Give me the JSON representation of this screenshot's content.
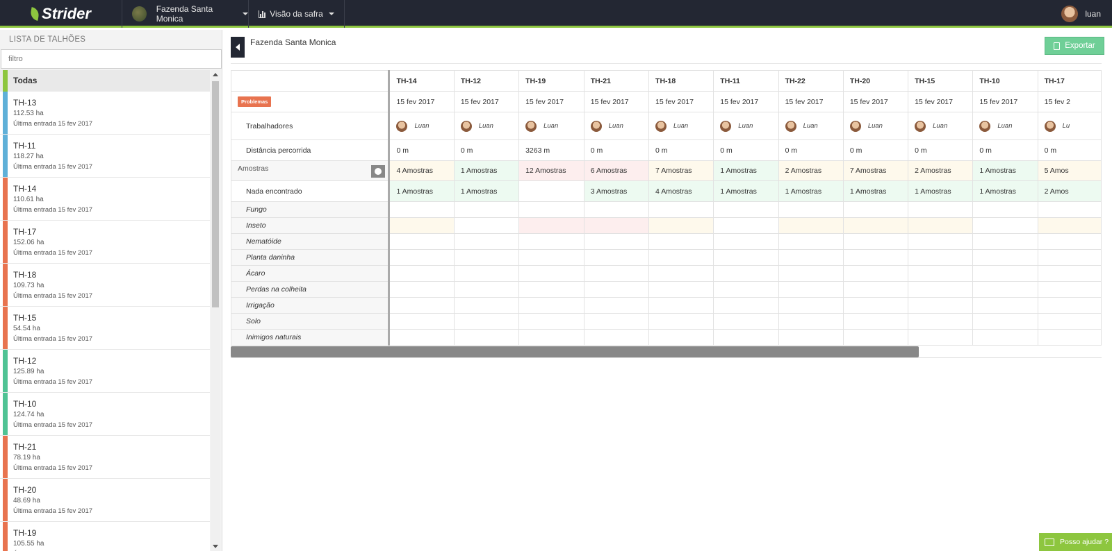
{
  "app": {
    "name": "Strider",
    "accent": "#8dc63f",
    "topbar_bg": "#232733"
  },
  "header": {
    "farm": "Fazenda Santa Monica",
    "view": "Visão da safra",
    "user": "luan"
  },
  "sidebar": {
    "title": "LISTA DE TALHÕES",
    "filter_placeholder": "filtro",
    "all_label": "Todas",
    "items": [
      {
        "name": "TH-13",
        "area": "112.53 ha",
        "last": "Última entrada 15 fev 2017",
        "color": "#5fb0d8"
      },
      {
        "name": "TH-11",
        "area": "118.27 ha",
        "last": "Última entrada 15 fev 2017",
        "color": "#5fb0d8"
      },
      {
        "name": "TH-14",
        "area": "110.61 ha",
        "last": "Última entrada 15 fev 2017",
        "color": "#e8734f"
      },
      {
        "name": "TH-17",
        "area": "152.06 ha",
        "last": "Última entrada 15 fev 2017",
        "color": "#e8734f"
      },
      {
        "name": "TH-18",
        "area": "109.73 ha",
        "last": "Última entrada 15 fev 2017",
        "color": "#e8734f"
      },
      {
        "name": "TH-15",
        "area": "54.54 ha",
        "last": "Última entrada 15 fev 2017",
        "color": "#e8734f"
      },
      {
        "name": "TH-12",
        "area": "125.89 ha",
        "last": "Última entrada 15 fev 2017",
        "color": "#4fc394"
      },
      {
        "name": "TH-10",
        "area": "124.74 ha",
        "last": "Última entrada 15 fev 2017",
        "color": "#4fc394"
      },
      {
        "name": "TH-21",
        "area": "78.19 ha",
        "last": "Última entrada 15 fev 2017",
        "color": "#e8734f"
      },
      {
        "name": "TH-20",
        "area": "48.69 ha",
        "last": "Última entrada 15 fev 2017",
        "color": "#e8734f"
      },
      {
        "name": "TH-19",
        "area": "105.55 ha",
        "last": "Última entrada 15 fev 2017",
        "color": "#e8734f"
      }
    ]
  },
  "main": {
    "title": "Fazenda Santa Monica",
    "export_label": "Exportar",
    "columns": [
      "TH-14",
      "TH-12",
      "TH-19",
      "TH-21",
      "TH-18",
      "TH-11",
      "TH-22",
      "TH-20",
      "TH-15",
      "TH-10",
      "TH-17"
    ],
    "problems_badge": "Problemas",
    "dates": [
      "15 fev 2017",
      "15 fev 2017",
      "15 fev 2017",
      "15 fev 2017",
      "15 fev 2017",
      "15 fev 2017",
      "15 fev 2017",
      "15 fev 2017",
      "15 fev 2017",
      "15 fev 2017",
      "15 fev 2"
    ],
    "workers_label": "Trabalhadores",
    "workers": [
      "Luan",
      "Luan",
      "Luan",
      "Luan",
      "Luan",
      "Luan",
      "Luan",
      "Luan",
      "Luan",
      "Luan",
      "Lu"
    ],
    "distance_label": "Distância percorrida",
    "distances": [
      "0 m",
      "0 m",
      "3263 m",
      "0 m",
      "0 m",
      "0 m",
      "0 m",
      "0 m",
      "0 m",
      "0 m",
      "0 m"
    ],
    "samples_label": "Amostras",
    "samples": [
      {
        "text": "4 Amostras",
        "status": "yellow"
      },
      {
        "text": "1 Amostras",
        "status": "green"
      },
      {
        "text": "12 Amostras",
        "status": "red"
      },
      {
        "text": "6 Amostras",
        "status": "red"
      },
      {
        "text": "7 Amostras",
        "status": "yellow"
      },
      {
        "text": "1 Amostras",
        "status": "green"
      },
      {
        "text": "2 Amostras",
        "status": "yellow"
      },
      {
        "text": "7 Amostras",
        "status": "yellow"
      },
      {
        "text": "2 Amostras",
        "status": "yellow"
      },
      {
        "text": "1 Amostras",
        "status": "green"
      },
      {
        "text": "5 Amos",
        "status": "yellow"
      }
    ],
    "nothing_label": "Nada encontrado",
    "nothing": [
      {
        "text": "1 Amostras",
        "status": "green"
      },
      {
        "text": "1 Amostras",
        "status": "green"
      },
      {
        "text": "",
        "status": "none"
      },
      {
        "text": "3 Amostras",
        "status": "green"
      },
      {
        "text": "4 Amostras",
        "status": "green"
      },
      {
        "text": "1 Amostras",
        "status": "green"
      },
      {
        "text": "1 Amostras",
        "status": "green"
      },
      {
        "text": "1 Amostras",
        "status": "green"
      },
      {
        "text": "1 Amostras",
        "status": "green"
      },
      {
        "text": "1 Amostras",
        "status": "green"
      },
      {
        "text": "2 Amos",
        "status": "green"
      }
    ],
    "categories": [
      "Fungo",
      "Inseto",
      "Nematóide",
      "Planta daninha",
      "Ácaro",
      "Perdas na colheita",
      "Irrigação",
      "Solo",
      "Inimigos naturais"
    ],
    "insect_status": [
      "yellow",
      "none",
      "red",
      "red",
      "yellow",
      "none",
      "yellow",
      "yellow",
      "yellow",
      "none",
      "yellow"
    ]
  },
  "help_label": "Posso ajudar ?"
}
